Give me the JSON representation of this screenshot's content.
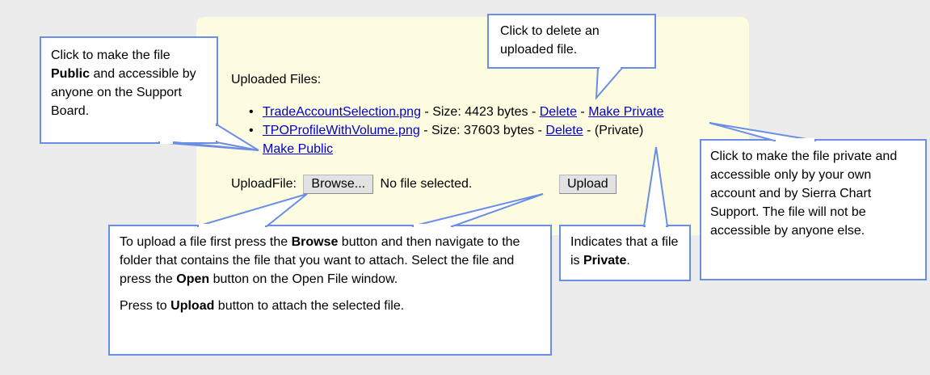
{
  "panel": {
    "uploaded_title": "Uploaded Files:",
    "files": [
      {
        "name": "TradeAccountSelection.png",
        "size_text": " - Size: 4423 bytes - ",
        "delete_label": "Delete",
        "sep": " - ",
        "visibility_link": "Make Private",
        "status": ""
      },
      {
        "name": "TPOProfileWithVolume.png",
        "size_text": " - Size: 37603 bytes - ",
        "delete_label": "Delete",
        "sep": " - ",
        "status": "(Private)",
        "visibility_link": "Make Public"
      }
    ],
    "upload_label": "UploadFile:",
    "browse_label": "Browse...",
    "no_file_text": "No file selected.",
    "upload_button": "Upload"
  },
  "callouts": {
    "make_public": {
      "line1": "Click to make the file",
      "bold": "Public",
      "line2": " and accessible by anyone on the Support Board."
    },
    "delete": {
      "text": "Click to delete an uploaded file."
    },
    "make_private": {
      "text": "Click to make the file private and accessible only by your own account and by Sierra Chart Support.  The file will not be accessible by anyone else."
    },
    "private_indicator": {
      "pre": "Indicates that a file is ",
      "bold": "Private",
      "post": "."
    },
    "upload_help": {
      "p1_pre": "To upload a file first press the ",
      "p1_bold1": "Browse",
      "p1_mid": " button and then navigate to the folder that contains the file that you want to attach.  Select the file and press the ",
      "p1_bold2": "Open",
      "p1_post": " button on the Open File window.",
      "p2_pre": "Press to ",
      "p2_bold": "Upload",
      "p2_post": " button to attach the selected file."
    }
  },
  "colors": {
    "panel_bg": "#fdfbe0",
    "callout_border": "#6a8ee6",
    "link": "#0000cc",
    "page_bg": "#ececec"
  }
}
